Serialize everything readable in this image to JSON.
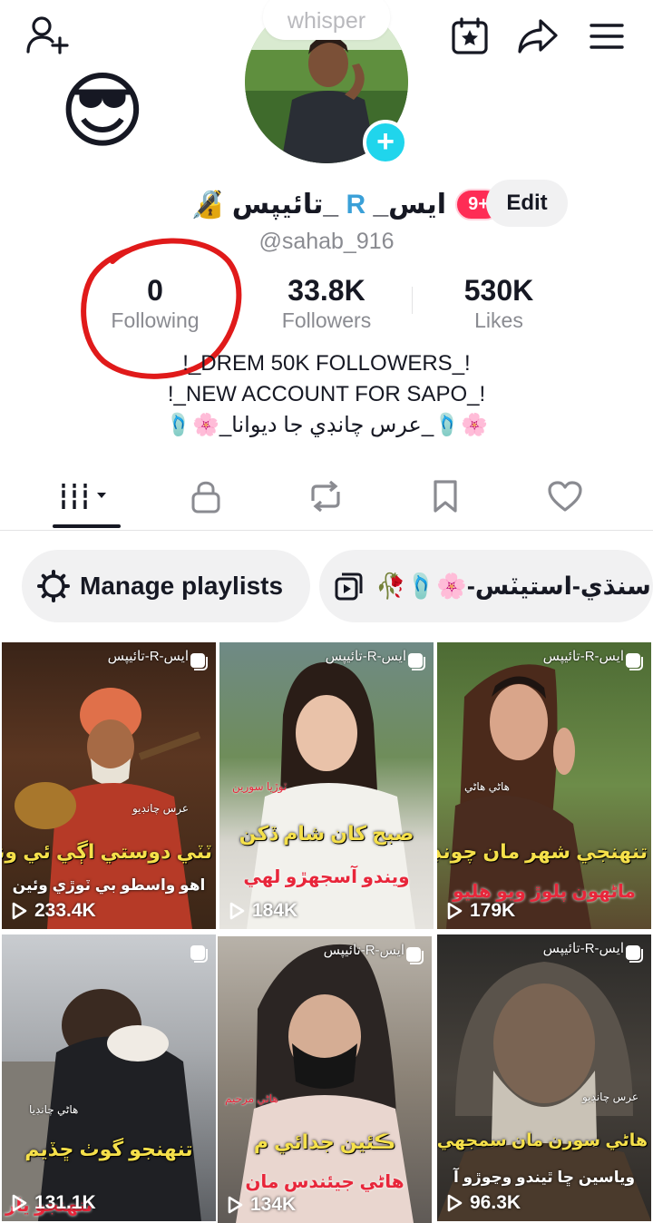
{
  "header": {
    "add_user_icon": "person-add-icon",
    "calendar_icon": "calendar-star-icon",
    "share_icon": "share-arrow-icon",
    "menu_icon": "hamburger-menu-icon",
    "sticker": "😎"
  },
  "profile": {
    "whisper_text": "whisper",
    "name_prefix": "🔏",
    "name_part1": "_تائيپس",
    "name_r": "R",
    "name_part2": "ايس_",
    "notification_badge": "9+",
    "edit_label": "Edit",
    "username": "@sahab_916"
  },
  "stats": {
    "following_value": "0",
    "following_label": "Following",
    "followers_value": "33.8K",
    "followers_label": "Followers",
    "likes_value": "530K",
    "likes_label": "Likes"
  },
  "bio": {
    "line1": "!_DREM 50K FOLLOWERS_!",
    "line2": "!_NEW ACCOUNT FOR SAPO_!",
    "line3": "🌸🩴_عرس چانڊي جا ديوانا_🌸🩴"
  },
  "tabs": {
    "videos_icon": "grid-icon",
    "private_icon": "lock-icon",
    "reposts_icon": "repost-icon",
    "saved_icon": "bookmark-icon",
    "liked_icon": "heart-icon"
  },
  "playlists": {
    "manage_label": "Manage playlists",
    "chip_label": "سنڌي-استيٽس-🌸🩴🥀"
  },
  "videos": [
    {
      "top_caption": "ايس-R-تائيپس",
      "tag": "عرس چانڊيو",
      "yellow": "ٽٽي دوستي اڳي ئي وني",
      "white": "اهو واسطو بي ٽوڙي وئين",
      "red": "",
      "views": "233.4K"
    },
    {
      "top_caption": "ايس-R-تائيپس",
      "tag": "ٽوڙيا سورين",
      "yellow": "صبح کان شام ڏکن",
      "white": "",
      "red": "ويندو آسجهڙو لهي",
      "views": "184K"
    },
    {
      "top_caption": "ايس-R-تائيپس",
      "tag": "هاڻي هاڻي",
      "yellow": "تنهنجي شهر مان چونڊجي",
      "white": "",
      "red": "ماڻهون پلوڙ ويو هليو",
      "views": "179K"
    },
    {
      "top_caption": "",
      "tag": "هاڻي چانڊيا",
      "yellow": "تنهنجو گوٺ ڇڏيم",
      "white": "",
      "red": "تنهنجو يار",
      "views": "131.1K"
    },
    {
      "top_caption": "ايس-R-تائيپس",
      "tag": "هاڻي مرحيم",
      "yellow": "ڪئين جدائي م",
      "white": "",
      "red": "هاڻي جيئندس مان",
      "views": "134K"
    },
    {
      "top_caption": "ايس-R-تائيپس",
      "tag": "عرس چانڊيو",
      "yellow": "هاڻي سورن مان سمجهي",
      "white": "وياسين ڇا ٿيندو وڃوڙو آ",
      "red": "",
      "views": "96.3K"
    }
  ]
}
